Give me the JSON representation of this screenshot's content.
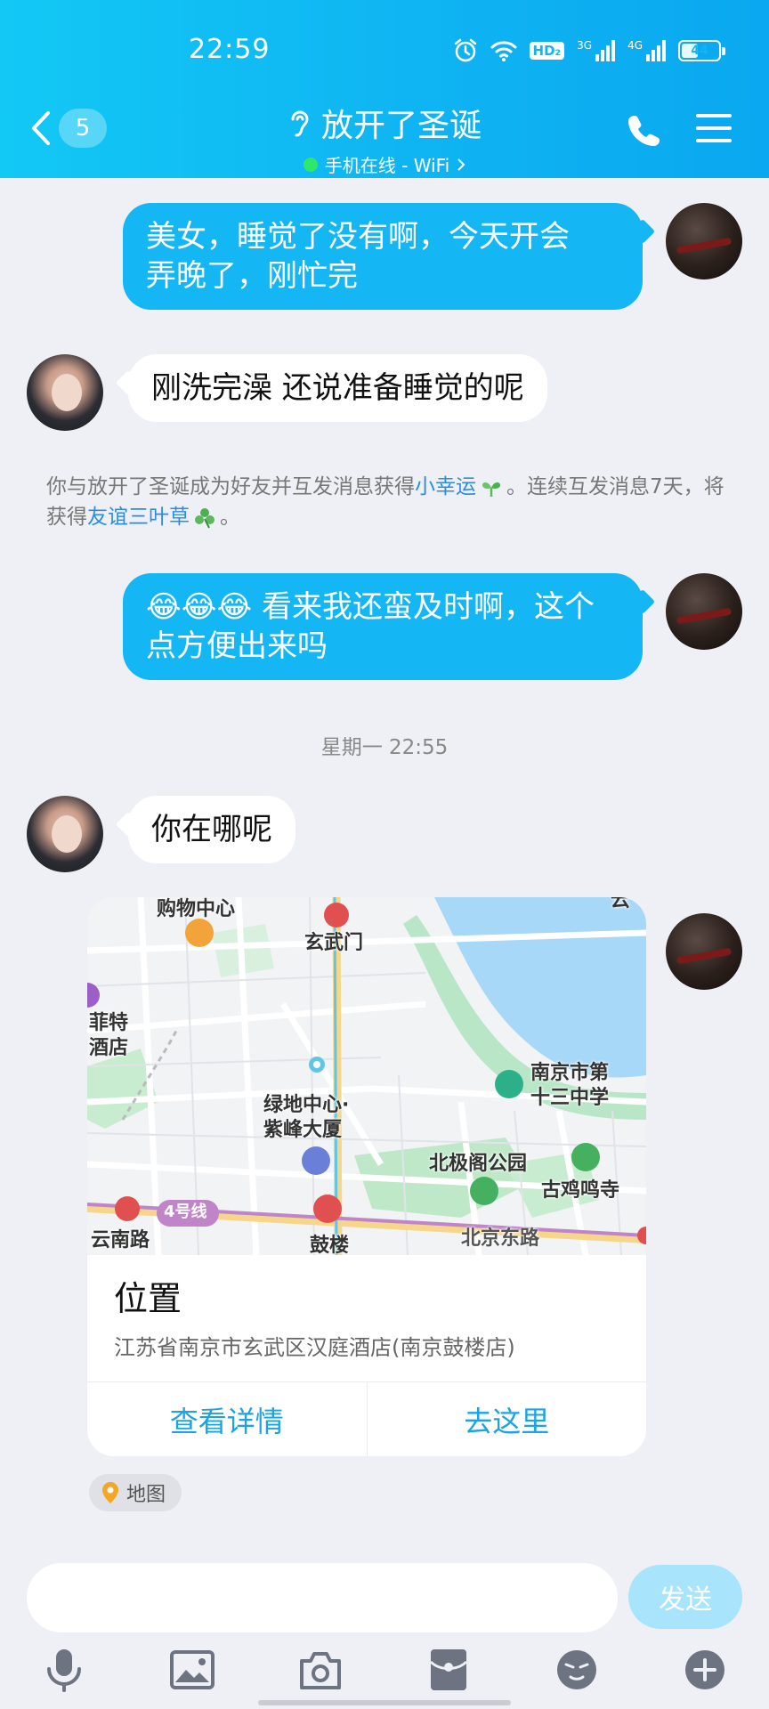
{
  "status_bar": {
    "time": "22:59",
    "hd_label": "HD₂",
    "net1_label": "3G",
    "net2_label": "4G",
    "battery": "44",
    "battery_level": 0.44,
    "icons": [
      "alarm-icon",
      "wifi-icon",
      "hd-badge",
      "signal-3g-icon",
      "signal-4g-icon",
      "battery-icon"
    ]
  },
  "header": {
    "unread_count": "5",
    "contact_name": "放开了圣诞",
    "online_status": "手机在线 - WiFi",
    "icons": [
      "back-icon",
      "ear-icon",
      "phone-icon",
      "menu-icon"
    ]
  },
  "messages": [
    {
      "from": "me",
      "text": "美女，睡觉了没有啊，今天开会\n弄晚了，刚忙完"
    },
    {
      "from": "her",
      "text": "刚洗完澡 还说准备睡觉的呢"
    },
    {
      "from": "me",
      "text": "看来我还蛮及时啊，这个\n点方便出来吗",
      "emoji": "😂😂😂"
    },
    {
      "from": "her",
      "text": "你在哪呢"
    }
  ],
  "system_tip": {
    "part1": "你与放开了圣诞成为好友并互发消息获得",
    "link1": "小幸运",
    "part2": "。连续互发消息7天，将获得",
    "link2": "友谊三叶草",
    "part3": "。"
  },
  "timestamp": "星期一 22:55",
  "location_card": {
    "title": "位置",
    "address": "江苏省南京市玄武区汉庭酒店(南京鼓楼店)",
    "view_details": "查看详情",
    "go_here": "去这里",
    "map_labels": {
      "shopping": "购物中心",
      "xuanwumen": "玄武门",
      "feite": "菲特\n酒店",
      "nanjing13": "南京市第\n十三中学",
      "greenland": "绿地中心·\n紫峰大厦",
      "beijige": "北极阁公园",
      "jimingsi": "古鸡鸣寺",
      "line4": "4号线",
      "yunnanlu": "云南路",
      "gulou": "鼓楼",
      "beijingdonglu": "北京东路",
      "edge_top": "云"
    }
  },
  "map_tag": "地图",
  "input": {
    "placeholder": "",
    "send_label": "发送"
  },
  "toolbar": {
    "icons": [
      "microphone-icon",
      "image-icon",
      "camera-icon",
      "red-packet-icon",
      "emoji-icon",
      "plus-icon"
    ]
  },
  "colors": {
    "header_blue": "#12c8f5",
    "my_bubble": "#14b6f4",
    "link_blue": "#2b8be6",
    "background": "#eef0f6"
  }
}
